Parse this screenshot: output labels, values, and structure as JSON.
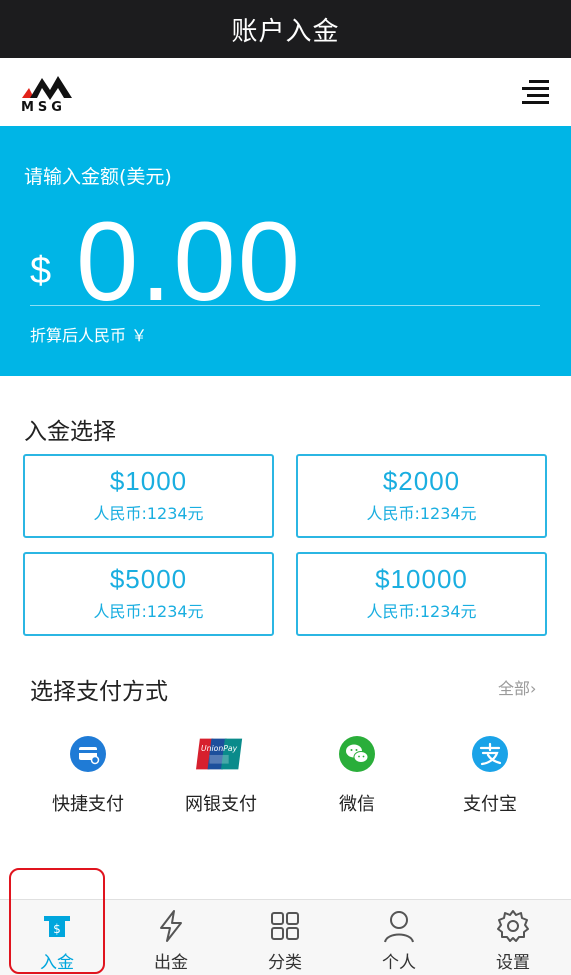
{
  "window": {
    "title": "账户入金"
  },
  "header": {
    "logo_text": "MSG"
  },
  "deposit": {
    "prompt": "请输入金额(美元)",
    "currency_symbol": "$",
    "amount": "0.00",
    "converted_label": "折算后人民币 ￥"
  },
  "options": {
    "title": "入金选择",
    "items": [
      {
        "usd": "$1000",
        "cny": "人民币:1234元"
      },
      {
        "usd": "$2000",
        "cny": "人民币:1234元"
      },
      {
        "usd": "$5000",
        "cny": "人民币:1234元"
      },
      {
        "usd": "$10000",
        "cny": "人民币:1234元"
      }
    ]
  },
  "payment": {
    "title": "选择支付方式",
    "all_label": "全部",
    "methods": [
      {
        "label": "快捷支付",
        "icon": "card-icon"
      },
      {
        "label": "网银支付",
        "icon": "unionpay-icon"
      },
      {
        "label": "微信",
        "icon": "wechat-icon"
      },
      {
        "label": "支付宝",
        "icon": "alipay-icon"
      }
    ]
  },
  "tabbar": {
    "active": 0,
    "items": [
      {
        "label": "入金",
        "icon": "deposit-icon"
      },
      {
        "label": "出金",
        "icon": "lightning-icon"
      },
      {
        "label": "分类",
        "icon": "grid-icon"
      },
      {
        "label": "个人",
        "icon": "person-icon"
      },
      {
        "label": "设置",
        "icon": "gear-icon"
      }
    ]
  },
  "colors": {
    "accent": "#00b5e6",
    "titlebar": "#1c1c1e",
    "highlight": "#e0141e",
    "logo_red": "#e2231a"
  }
}
